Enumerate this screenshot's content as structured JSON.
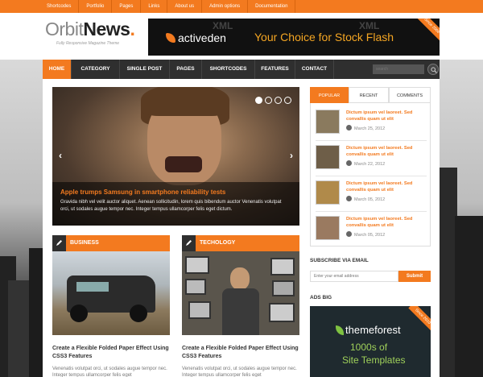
{
  "topbar": {
    "items": [
      "Shortcodes",
      "Portfolio",
      "Pages",
      "Links",
      "About us",
      "Admin options",
      "Documentation"
    ]
  },
  "header": {
    "logo_light": "Orbit",
    "logo_bold": "News",
    "logo_dot": ".",
    "tagline": "Fully Responsive Magazine Theme"
  },
  "banner": {
    "brand": "activeden",
    "text": "Your Choice for Stock Flash",
    "corner": "Since 2006",
    "xml_text": "XML"
  },
  "nav": {
    "items": [
      "HOME",
      "CATEGORY",
      "SINGLE POST",
      "PAGES",
      "SHORTCODES",
      "FEATURES",
      "CONTACT"
    ],
    "search_placeholder": "search"
  },
  "slider": {
    "title": "Apple trumps Samsung in smartphone reliability tests",
    "text": "Gravida nibh vel velit auctor aliquet. Aenean sollicitudin, lorem quis bibendum auctor Venenatis volutpat orci, ut sodales augue tempor nec. Integer tempus ullamcorper felis eget dictum.",
    "prev": "‹",
    "next": "›"
  },
  "categories": [
    {
      "heading": "BUSINESS",
      "title": "Create a Flexible Folded Paper Effect Using CSS3 Features",
      "text": "Venenatis volutpat orci, ut sodales augue tempor nec. Integer tempus ullamcorper felis eget"
    },
    {
      "heading": "TECHOLOGY",
      "title": "Create a Flexible Folded Paper Effect Using CSS3 Features",
      "text": "Venenatis volutpat orci, ut sodales augue tempor nec. Integer tempus ullamcorper felis eget"
    }
  ],
  "sidebar": {
    "tabs": [
      "POPULAR",
      "RECENT",
      "COMMENTS"
    ],
    "posts": [
      {
        "title": "Dictum ipsum vel laoreet. Sed convallis quam ut elit",
        "date": "March 25, 2012"
      },
      {
        "title": "Dictum ipsum vel laoreet. Sed convallis quam ut elit",
        "date": "March 22, 2012"
      },
      {
        "title": "Dictum ipsum vel laoreet. Sed convallis quam ut elit",
        "date": "March 05, 2012"
      },
      {
        "title": "Dictum ipsum vel laoreet. Sed convallis quam ut elit",
        "date": "March 05, 2012"
      }
    ],
    "subscribe_heading": "SUBSCRIBE VIA EMAIL",
    "subscribe_placeholder": "Enter your email address",
    "subscribe_button": "Submit",
    "ads_heading": "ADS BIG",
    "ads_brand": "themeforest",
    "ads_line1": "1000s of",
    "ads_line2": "Site Templates",
    "ads_corner": "Since 2010"
  },
  "colors": {
    "accent": "#f37a1f",
    "nav_bg": "#2f2f2f"
  }
}
